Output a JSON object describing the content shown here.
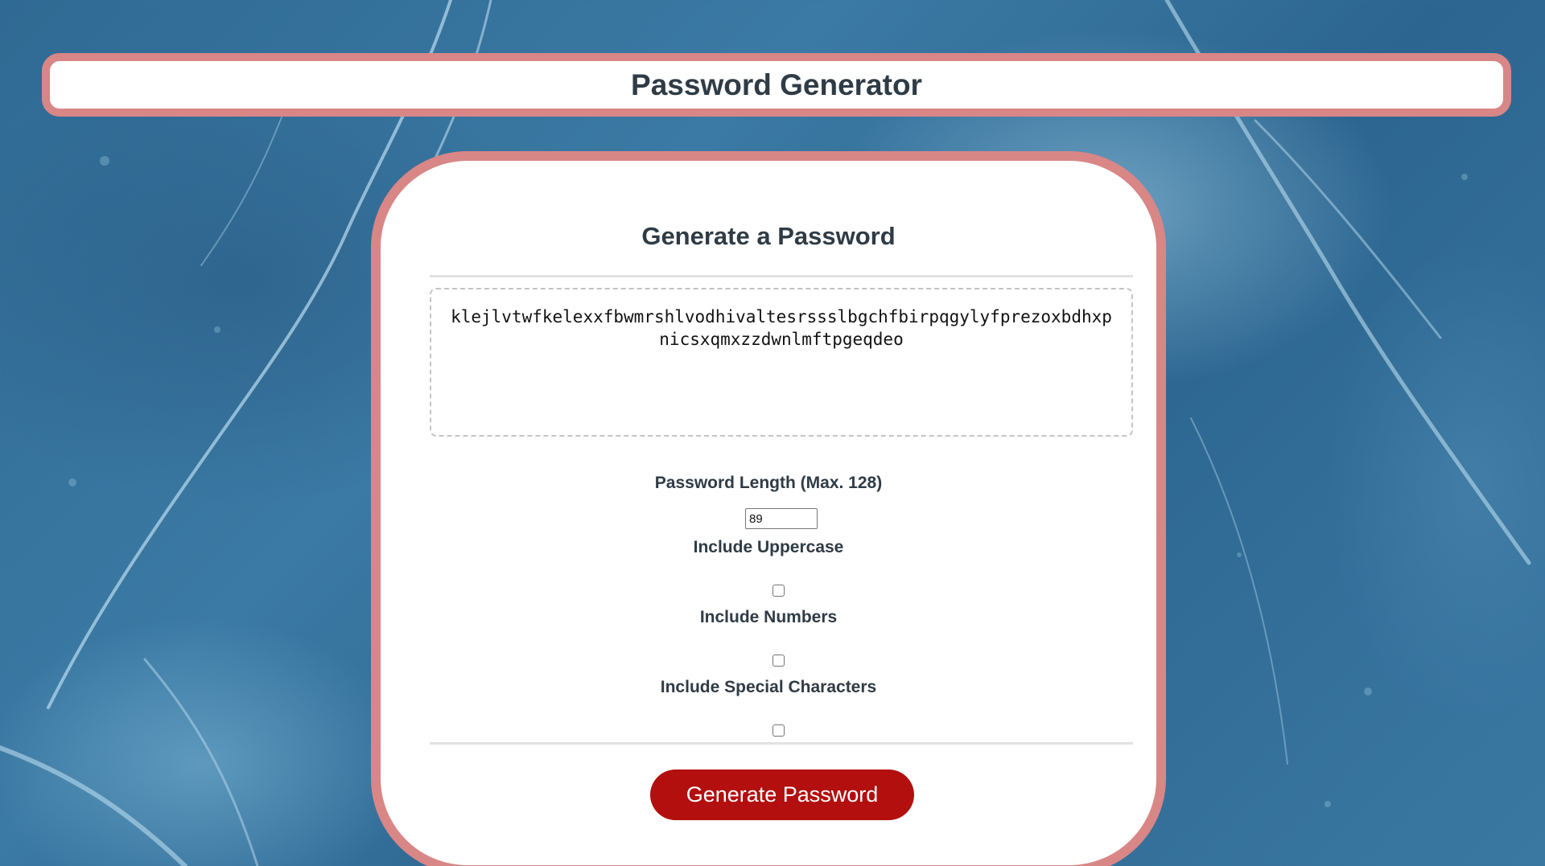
{
  "header": {
    "title": "Password Generator"
  },
  "card": {
    "title": "Generate a Password",
    "password_output": "klejlvtwfkelexxfbwmrshlvodhivaltesrssslbgchfbirpqgylyfprezoxbdhxpnicsxqmxzzdwnlmftpgeqdeo",
    "length_label": "Password Length (Max. 128)",
    "length_value": "89",
    "uppercase_label": "Include Uppercase",
    "uppercase_checked": false,
    "numbers_label": "Include Numbers",
    "numbers_checked": false,
    "special_label": "Include Special Characters",
    "special_checked": false,
    "generate_button_label": "Generate Password"
  },
  "colors": {
    "border_accent": "#d98686",
    "button": "#b30f0f",
    "heading_text": "#2f3b45"
  }
}
